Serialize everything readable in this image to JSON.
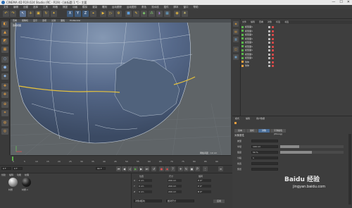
{
  "window": {
    "title": "CINEMA 4D R19.024 Studio (RC - R19) - [未标题 1 *] - 主要",
    "controls": [
      "—",
      "☐",
      "✕"
    ]
  },
  "menu": [
    "文件",
    "编辑",
    "创建",
    "选择",
    "工具",
    "网格",
    "捕捉",
    "动画",
    "模拟",
    "渲染",
    "雕刻",
    "运动跟踪",
    "运动图形",
    "角色",
    "流水线",
    "插件",
    "脚本",
    "窗口",
    "帮助"
  ],
  "toolbar": {
    "icons": [
      "undo-icon",
      "redo-icon",
      "select-icon",
      "move-icon",
      "scale-icon",
      "rotate-icon",
      "recent-icon",
      "x-axis",
      "y-axis",
      "z-axis",
      "coord-icon",
      "render-view-icon",
      "render-icon",
      "render-settings-icon",
      "cube-icon",
      "pen-icon",
      "subdivide-icon",
      "array-icon",
      "deformer-icon",
      "floor-icon",
      "camera-icon",
      "light-icon"
    ],
    "axis_labels": [
      "X",
      "Y",
      "Z"
    ]
  },
  "viewport": {
    "menu": [
      "查看",
      "摄像机",
      "显示",
      "选项",
      "过滤",
      "面板",
      "ProRender"
    ],
    "label": "透视视图",
    "grid_info": "网格间距 : 10 cm",
    "colors": {
      "background": "#5f6467",
      "mesh": "#475a72",
      "edges": "#c8d2de",
      "selection": "#e8c33a"
    }
  },
  "objects": {
    "header": [
      "文件",
      "编辑",
      "查看",
      "对象",
      "标签",
      "书签"
    ],
    "rows": [
      "模型面1",
      "模型面1",
      "模型面1",
      "模型面1",
      "模型面1",
      "模型面1",
      "模型面1",
      "模型面1",
      "模型面1",
      "球体",
      "球体"
    ]
  },
  "attributes": {
    "tabs": [
      "模式",
      "编辑",
      "用户数据"
    ],
    "subtabs": [
      "基本",
      "坐标",
      "对象",
      "平滑着色(Phong)"
    ],
    "section_title": "对象属性",
    "fields": [
      {
        "label": "类型",
        "value": ""
      },
      {
        "label": "半径",
        "value": "100 cm"
      },
      {
        "label": "强度",
        "value": "50 %"
      },
      {
        "label": "分段",
        "value": "1"
      },
      {
        "label": "线宽",
        "value": ""
      },
      {
        "label": "预览",
        "value": ""
      }
    ]
  },
  "timeline": {
    "ticks": [
      "0",
      "5",
      "10",
      "15",
      "20",
      "25",
      "30",
      "35",
      "40",
      "45",
      "50",
      "55",
      "60",
      "65",
      "70",
      "75",
      "80",
      "85",
      "90"
    ],
    "frame_end": "90 F",
    "frame_start": "0 F",
    "current": "0 F"
  },
  "coords": {
    "headers": [
      "位置",
      "尺寸",
      "旋转"
    ],
    "rows": [
      {
        "axis": "X",
        "pos": "0 cm",
        "size": "200 cm",
        "rot": "H 0°"
      },
      {
        "axis": "Y",
        "pos": "0 cm",
        "size": "200 cm",
        "rot": "P 0°"
      },
      {
        "axis": "Z",
        "pos": "0 cm",
        "size": "200 cm",
        "rot": "B 0°"
      }
    ],
    "mode": "对象(相对)",
    "size_mode": "绝对尺寸",
    "apply": "应用"
  },
  "materials": {
    "menu": [
      "创建",
      "编辑",
      "功能",
      "纹理"
    ],
    "names": [
      "材质",
      "材质.1"
    ]
  },
  "watermark": {
    "brand": "Baidu 经验",
    "url": "jingyan.baidu.com"
  }
}
